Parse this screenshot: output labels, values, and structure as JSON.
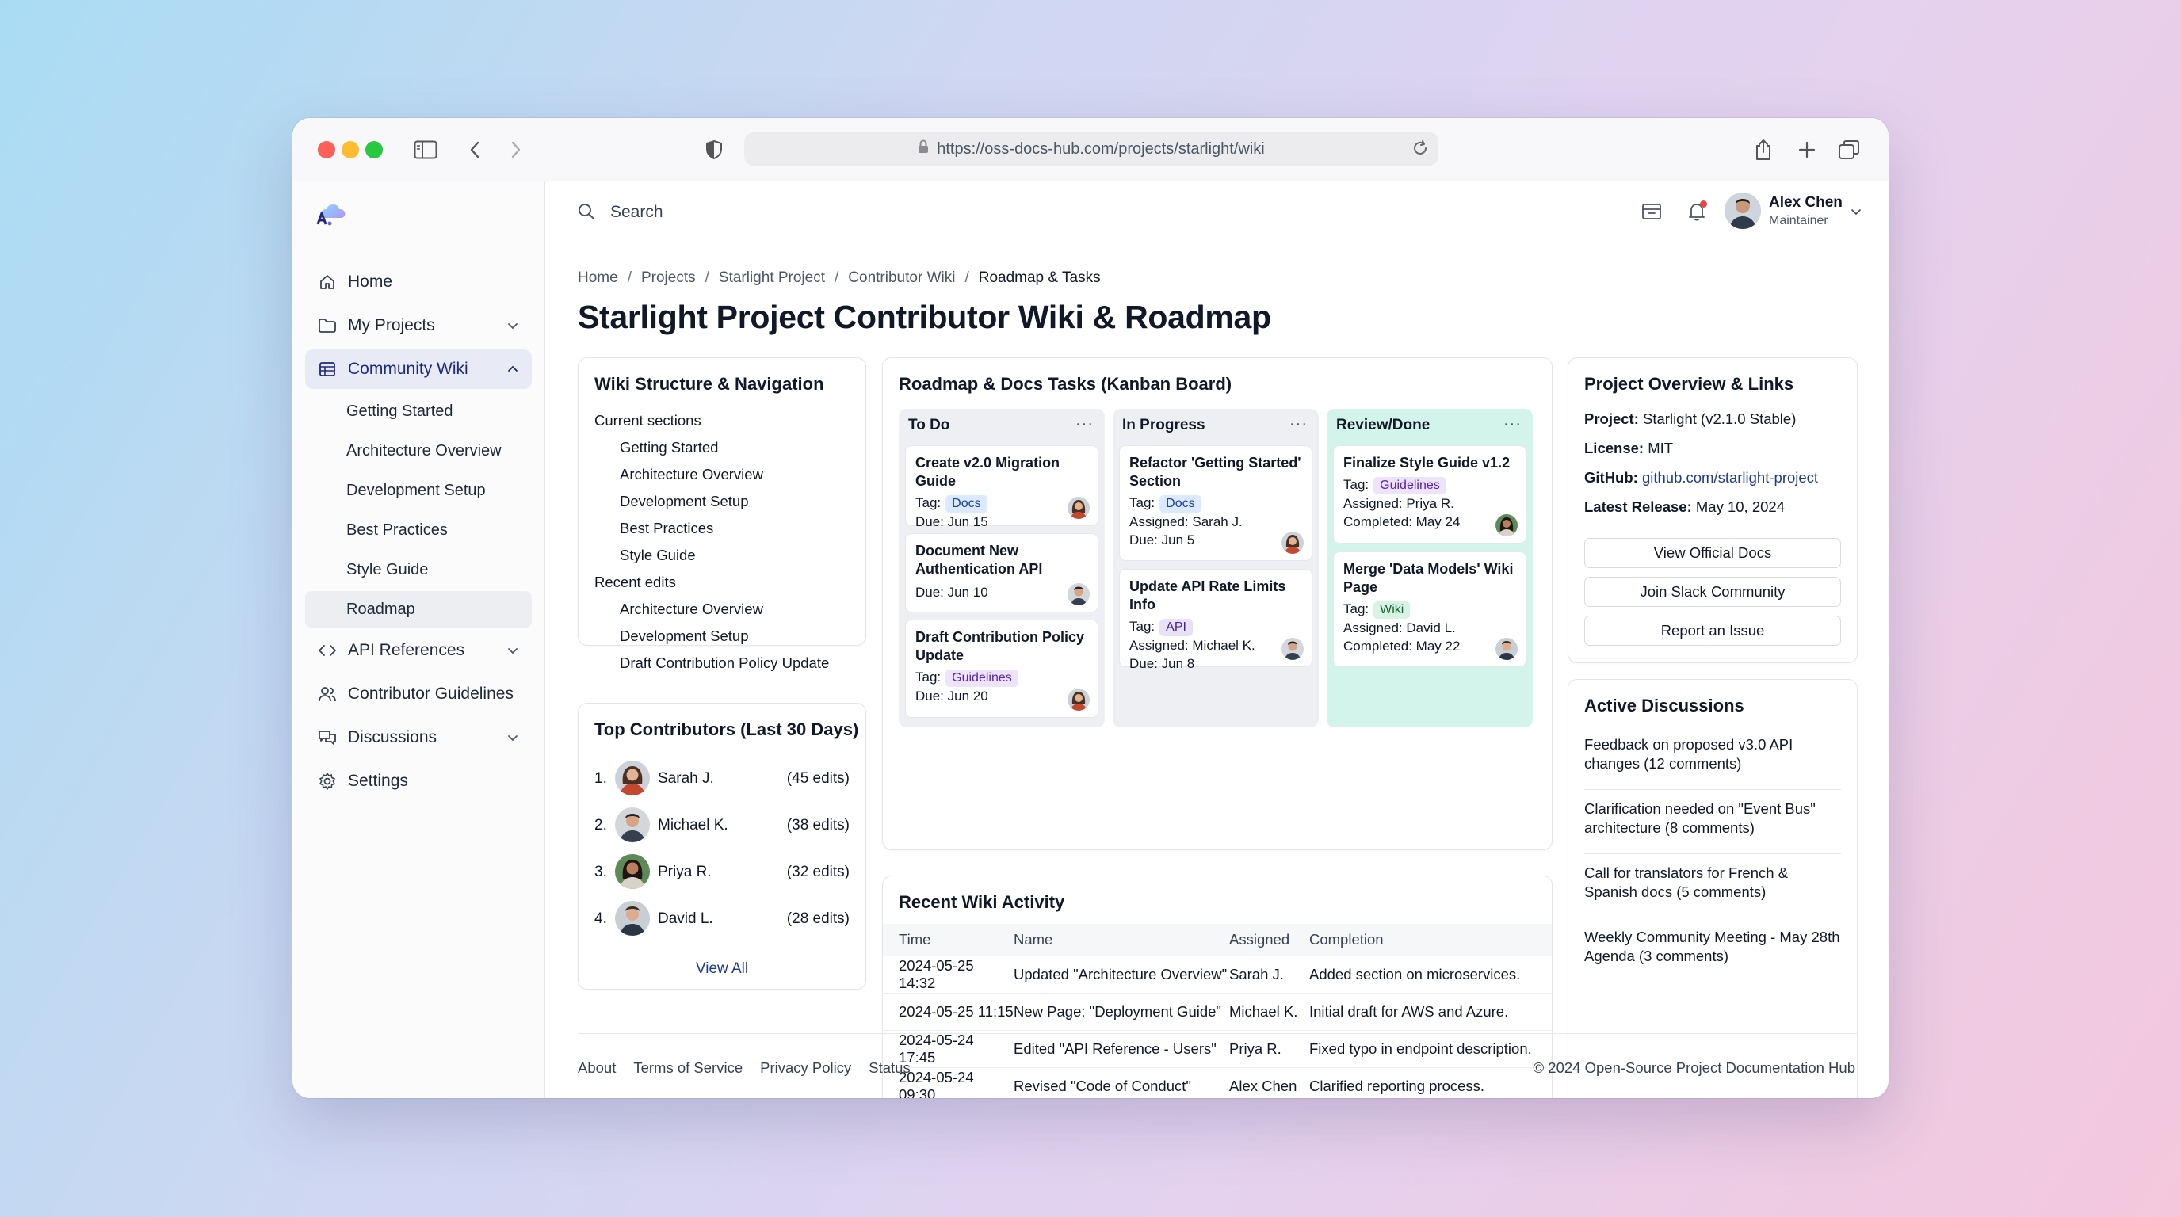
{
  "browser": {
    "url": "https://oss-docs-hub.com/projects/starlight/wiki"
  },
  "sidebar": {
    "items": [
      {
        "label": "Home",
        "icon": "home-icon"
      },
      {
        "label": "My Projects",
        "icon": "folder-icon"
      },
      {
        "label": "Community Wiki",
        "icon": "table-icon"
      },
      {
        "label": "API References",
        "icon": "code-icon"
      },
      {
        "label": "Contributor Guidelines",
        "icon": "users-icon"
      },
      {
        "label": "Discussions",
        "icon": "chat-icon"
      },
      {
        "label": "Settings",
        "icon": "gear-icon"
      }
    ],
    "wiki_sub": [
      "Getting Started",
      "Architecture Overview",
      "Development Setup",
      "Best Practices",
      "Style Guide",
      "Roadmap"
    ]
  },
  "topbar": {
    "search_placeholder": "Search",
    "user_name": "Alex Chen",
    "user_role": "Maintainer"
  },
  "breadcrumb": [
    "Home",
    "Projects",
    "Starlight Project",
    "Contributor Wiki",
    "Roadmap & Tasks"
  ],
  "page_title": "Starlight Project Contributor Wiki & Roadmap",
  "wiki_structure": {
    "title": "Wiki Structure & Navigation",
    "current_label": "Current sections",
    "current": [
      "Getting Started",
      "Architecture Overview",
      "Development Setup",
      "Best Practices",
      "Style Guide"
    ],
    "recent_label": "Recent edits",
    "recent": [
      "Architecture Overview",
      "Development Setup",
      "Draft Contribution Policy Update"
    ]
  },
  "contributors": {
    "title": "Top Contributors (Last 30 Days)",
    "rows": [
      {
        "num": "1.",
        "name": "Sarah J.",
        "edits": "(45 edits)"
      },
      {
        "num": "2.",
        "name": "Michael K.",
        "edits": "(38 edits)"
      },
      {
        "num": "3.",
        "name": "Priya R.",
        "edits": "(32 edits)"
      },
      {
        "num": "4.",
        "name": "David L.",
        "edits": "(28 edits)"
      }
    ],
    "view_all": "View All"
  },
  "kanban": {
    "title": "Roadmap & Docs Tasks (Kanban Board)",
    "more": "···",
    "tag_label": "Tag:",
    "columns": {
      "todo": {
        "name": "To Do",
        "cards": [
          {
            "title": "Create v2.0 Migration Guide",
            "tag": "Docs",
            "due": "Due: Jun 15"
          },
          {
            "title": "Document New Authentication API",
            "due": "Due: Jun 10"
          },
          {
            "title": "Draft Contribution Policy Update",
            "tag": "Guidelines",
            "due": "Due: Jun 20"
          }
        ]
      },
      "progress": {
        "name": "In Progress",
        "cards": [
          {
            "title": "Refactor 'Getting Started' Section",
            "tag": "Docs",
            "assigned": "Assigned: Sarah J.",
            "due": "Due: Jun 5"
          },
          {
            "title": "Update API Rate Limits Info",
            "tag": "API",
            "assigned": "Assigned: Michael K.",
            "due": "Due: Jun 8"
          }
        ]
      },
      "done": {
        "name": "Review/Done",
        "cards": [
          {
            "title": "Finalize Style Guide v1.2",
            "tag": "Guidelines",
            "assigned": "Assigned: Priya R.",
            "completed": "Completed: May 24"
          },
          {
            "title": "Merge 'Data Models' Wiki Page",
            "tag": "Wiki",
            "assigned": "Assigned: David L.",
            "completed": "Completed: May 22"
          }
        ]
      }
    }
  },
  "activity": {
    "title": "Recent Wiki Activity",
    "headers": [
      "Time",
      "Name",
      "Assigned",
      "Completion"
    ],
    "rows": [
      [
        "2024-05-25 14:32",
        "Updated \"Architecture Overview\"",
        "Sarah J.",
        "Added section on microservices."
      ],
      [
        "2024-05-25 11:15",
        "New Page: \"Deployment Guide\"",
        "Michael K.",
        "Initial draft for AWS and Azure."
      ],
      [
        "2024-05-24 17:45",
        "Edited \"API Reference - Users\"",
        "Priya R.",
        "Fixed typo in endpoint description."
      ],
      [
        "2024-05-24 09:30",
        "Revised \"Code of Conduct\"",
        "Alex Chen",
        "Clarified reporting process."
      ]
    ]
  },
  "overview": {
    "title": "Project Overview & Links",
    "project_label": "Project:",
    "project": "Starlight (v2.1.0 Stable)",
    "license_label": "License:",
    "license": "MIT",
    "github_label": "GitHub:",
    "github": "github.com/starlight-project",
    "release_label": "Latest Release:",
    "release": "May 10, 2024",
    "buttons": [
      "View Official Docs",
      "Join Slack Community",
      "Report an Issue"
    ]
  },
  "discussions": {
    "title": "Active Discussions",
    "items": [
      "Feedback on proposed v3.0 API changes (12 comments)",
      "Clarification needed on \"Event Bus\" architecture (8 comments)",
      "Call for translators for French & Spanish docs (5 comments)",
      "Weekly Community Meeting - May 28th Agenda (3 comments)"
    ]
  },
  "footer": {
    "links": [
      "About",
      "Terms of Service",
      "Privacy Policy",
      "Status"
    ],
    "copyright": "© 2024 Open-Source Project Documentation Hub"
  },
  "colors": {
    "accent": "#1e2a78",
    "done_column": "#d3f4ea",
    "column_bg": "#eeeff2",
    "notification": "#ef4444"
  }
}
